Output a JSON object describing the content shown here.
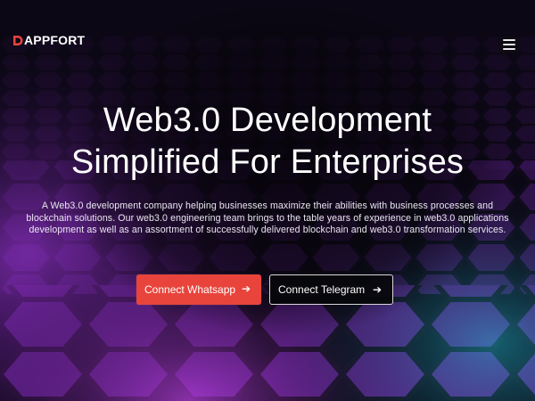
{
  "brand": {
    "name": "APPFORT",
    "logo_letter": "D",
    "accent": "#e8443c"
  },
  "nav": {
    "menu_icon": "hamburger-icon"
  },
  "hero": {
    "headline_line1": "Web3.0 Development",
    "headline_line2": "Simplified For Enterprises",
    "description": "A Web3.0 development company helping businesses maximize their abilities with business processes and blockchain solutions. Our web3.0 engineering team brings to the table years of experience in web3.0 applications development as well as an assortment of successfully delivered blockchain and web3.0 transformation services."
  },
  "cta": {
    "whatsapp_label": "Connect Whatsapp",
    "telegram_label": "Connect Telegram",
    "arrow_icon": "arrow-right-icon"
  },
  "colors": {
    "background": "#0b0714",
    "hex_purple": "#8a2cc4",
    "hex_teal": "#1fb6c9"
  }
}
